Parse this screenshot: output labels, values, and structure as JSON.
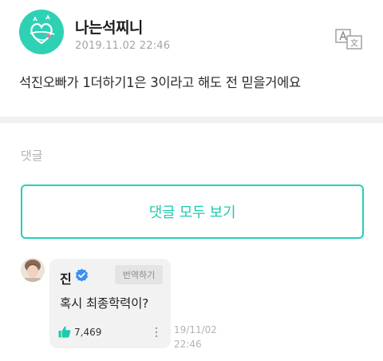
{
  "post": {
    "author": "나는석찌니",
    "timestamp": "2019.11.02 22:46",
    "body": "석진오빠가 1더하기1은 3이라고 해도 전 믿을거에요",
    "translate_icon": "translate-icon"
  },
  "comments_section": {
    "heading": "댓글",
    "view_all_label": "댓글 모두 보기"
  },
  "comment": {
    "author": "진",
    "verified_icon": "verified-badge-icon",
    "translate_label": "번역하기",
    "text": "혹시 최종학력이?",
    "likes": "7,469",
    "date": "19/11/02",
    "time": "22:46"
  },
  "colors": {
    "accent": "#1ecbad",
    "avatar_bg": "#2fd1b5",
    "verified": "#3d8ff0"
  }
}
